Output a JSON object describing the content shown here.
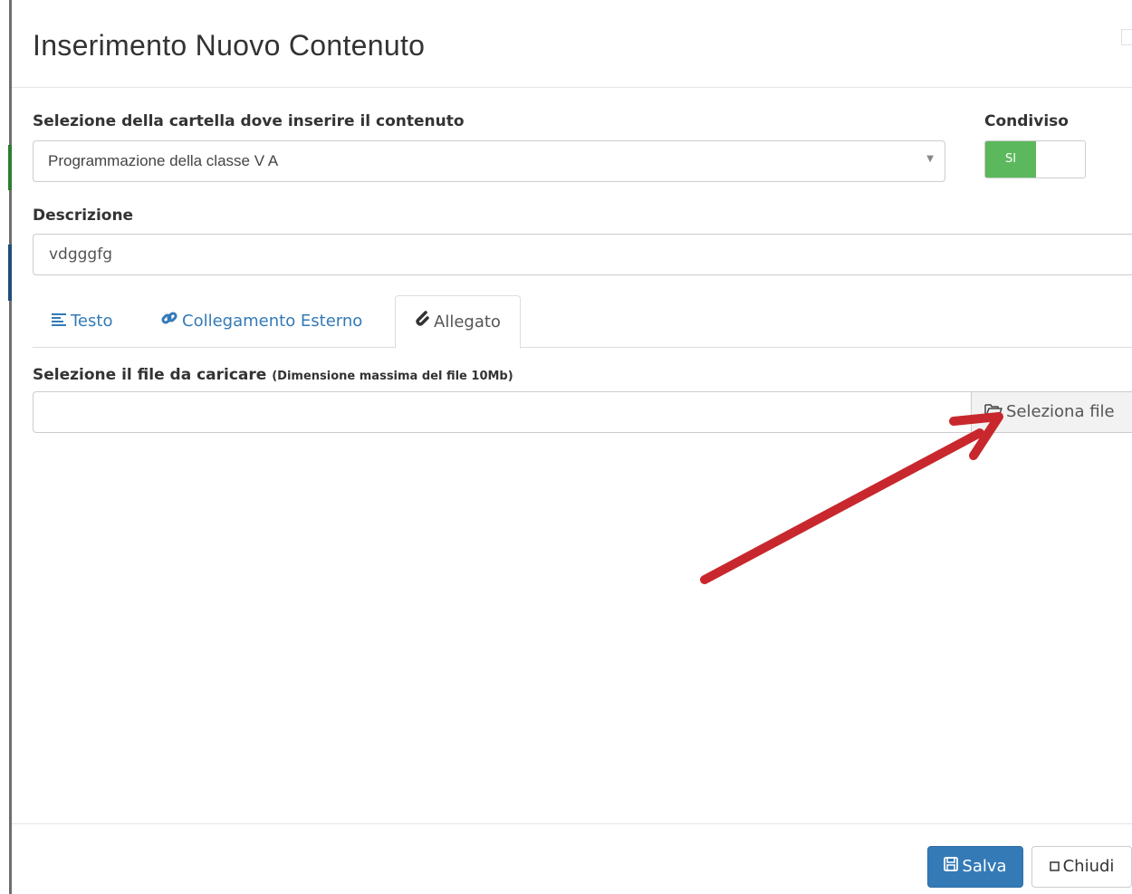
{
  "modal": {
    "title": "Inserimento Nuovo Contenuto"
  },
  "folder": {
    "label": "Selezione della cartella dove inserire il contenuto",
    "selected": "Programmazione della classe V A"
  },
  "shared": {
    "label": "Condiviso",
    "value": "SI",
    "on": true,
    "on_color": "#5cb85c"
  },
  "description": {
    "label": "Descrizione",
    "value": "vdgggfg"
  },
  "tabs": [
    {
      "label": "Testo",
      "icon": "text-align-icon",
      "active": false
    },
    {
      "label": "Collegamento Esterno",
      "icon": "link-icon",
      "active": false
    },
    {
      "label": "Allegato",
      "icon": "paperclip-icon",
      "active": true
    }
  ],
  "upload": {
    "label": "Selezione il file da caricare",
    "hint": "(Dimensione massima del file 10Mb)",
    "value": "",
    "button_label": "Seleziona file",
    "button_icon": "folder-open-icon"
  },
  "footer": {
    "save_label": "Salva",
    "save_icon": "save-icon",
    "close_label": "Chiudi",
    "close_icon": "square-icon"
  },
  "colors": {
    "primary": "#337ab7",
    "annotation_arrow": "#c8282d"
  }
}
